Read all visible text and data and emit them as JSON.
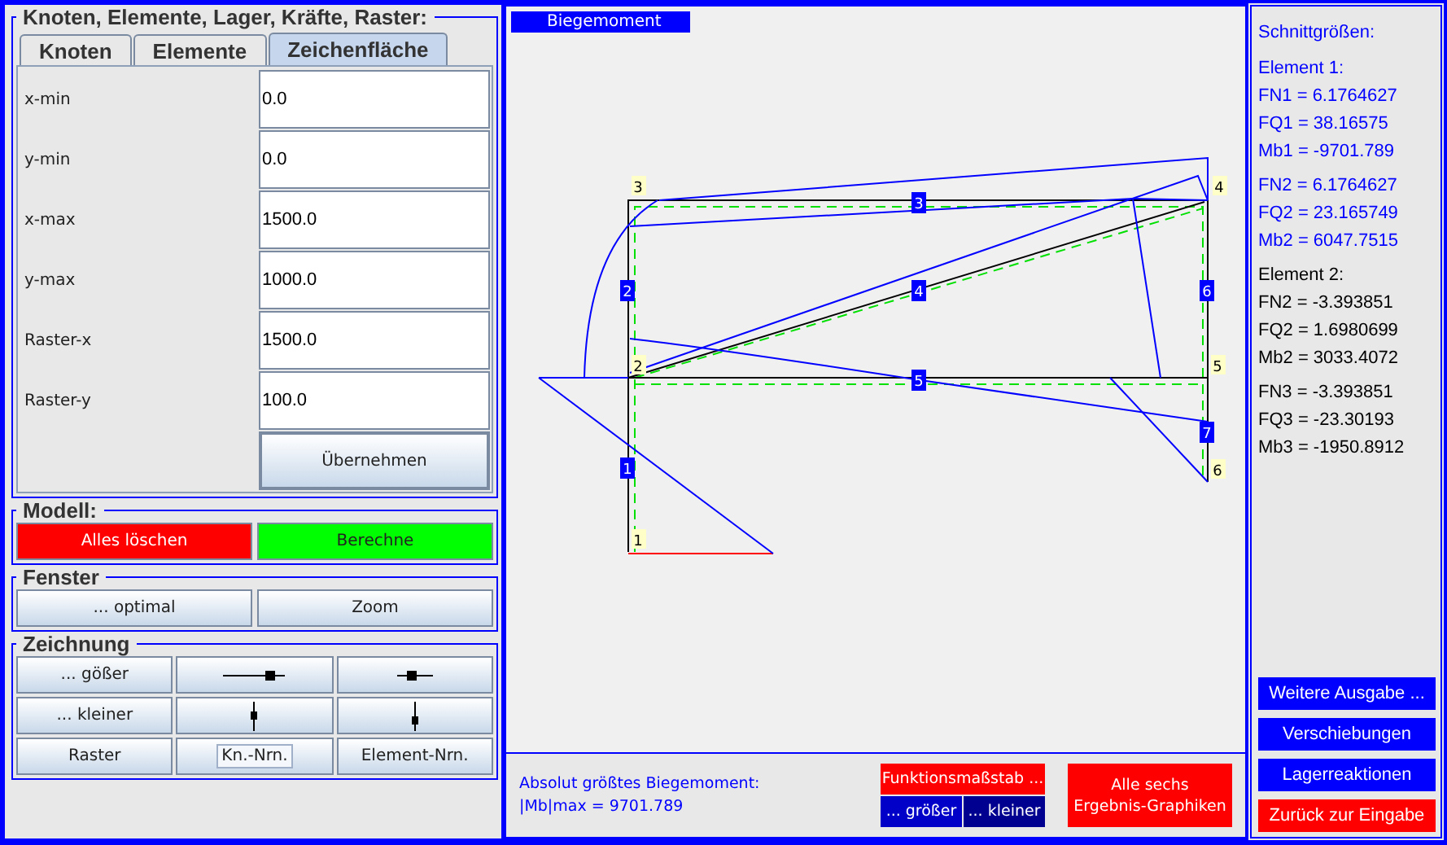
{
  "input_panel": {
    "title": "Knoten, Elemente, Lager, Kräfte, Raster:",
    "tabs": [
      {
        "label": "Knoten",
        "selected": false
      },
      {
        "label": "Elemente",
        "selected": false
      },
      {
        "label": "Zeichenfläche",
        "selected": true
      }
    ],
    "fields": [
      {
        "label": "x-min",
        "value": "0.0"
      },
      {
        "label": "y-min",
        "value": "0.0"
      },
      {
        "label": "x-max",
        "value": "1500.0"
      },
      {
        "label": "y-max",
        "value": "1000.0"
      },
      {
        "label": "Raster-x",
        "value": "1500.0"
      },
      {
        "label": "Raster-y",
        "value": "100.0"
      }
    ],
    "apply_button": "Übernehmen"
  },
  "model": {
    "title": "Modell:",
    "buttons": [
      {
        "label": "Alles löschen",
        "kind": "danger"
      },
      {
        "label": "Berechne",
        "kind": "go"
      }
    ]
  },
  "view": {
    "title": "Fenster",
    "buttons": [
      "... optimal",
      "Zoom"
    ]
  },
  "drawing": {
    "title": "Zeichnung",
    "buttons": [
      {
        "kind": "text",
        "label": "... gößer",
        "focused": false
      },
      {
        "kind": "move-right"
      },
      {
        "kind": "move-left"
      },
      {
        "kind": "text",
        "label": "... kleiner",
        "focused": false
      },
      {
        "kind": "move-up"
      },
      {
        "kind": "move-down"
      },
      {
        "kind": "text",
        "label": "Raster",
        "focused": false
      },
      {
        "kind": "text",
        "label": "Kn.-Nrn.",
        "focused": true
      },
      {
        "kind": "text",
        "label": "Element-Nrn.",
        "focused": false
      }
    ]
  },
  "canvas": {
    "title": "Biegemoment",
    "nodes": [
      "3",
      "4",
      "2",
      "5",
      "6",
      "1"
    ],
    "elements": [
      "3",
      "2",
      "4",
      "6",
      "5",
      "7",
      "1"
    ],
    "summary": [
      "Absolut größtes Biegemoment:",
      "|Mb|max = 9701.789"
    ],
    "scale_label": "Funktionsmaßstab ...",
    "scale_buttons": [
      "... größer",
      "... kleiner"
    ],
    "all_button": [
      "Alle sechs",
      "Ergebnis-Graphiken"
    ]
  },
  "results": {
    "title": "Schnittgrößen:",
    "groups": [
      {
        "title": "Element 1:",
        "color": "#0000ff",
        "blocks": [
          [
            "FN1 = 6.1764627",
            "FQ1 = 38.16575",
            "Mb1 = -9701.789"
          ],
          [
            "FN2 = 6.1764627",
            "FQ2 = 23.165749",
            "Mb2 = 6047.7515"
          ]
        ]
      },
      {
        "title": "Element 2:",
        "color": "#000000",
        "blocks": [
          [
            "FN2 = -3.393851",
            "FQ2 = 1.6980699",
            "Mb2 = 3033.4072"
          ],
          [
            "FN3 = -3.393851",
            "FQ3 = -23.30193",
            "Mb3 = -1950.8912"
          ]
        ]
      }
    ],
    "buttons": [
      {
        "label": "Weitere Ausgabe ...",
        "kind": "blue"
      },
      {
        "label": "Verschiebungen",
        "kind": "blue"
      },
      {
        "label": "Lagerreaktionen",
        "kind": "blue"
      },
      {
        "label": "Zurück zur Eingabe",
        "kind": "red"
      }
    ]
  }
}
